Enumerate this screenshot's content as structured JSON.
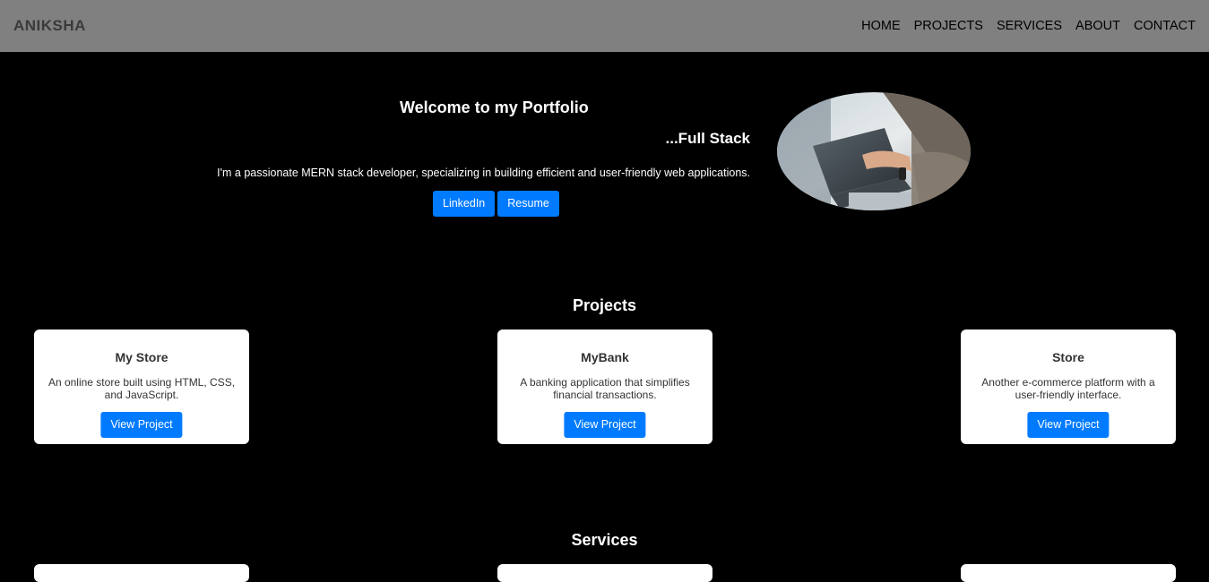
{
  "navbar": {
    "brand": "ANIKSHA",
    "links": [
      "HOME",
      "PROJECTS",
      "SERVICES",
      "ABOUT",
      "CONTACT"
    ]
  },
  "hero": {
    "title": "Welcome to my Portfolio",
    "role": "...Full Stack",
    "description": "I'm a passionate MERN stack developer, specializing in building efficient and user-friendly web applications.",
    "linkedin_label": "LinkedIn",
    "resume_label": "Resume"
  },
  "projects": {
    "heading": "Projects",
    "cards": [
      {
        "title": "My Store",
        "description": "An online store built using HTML, CSS, and JavaScript.",
        "button": "View Project"
      },
      {
        "title": "MyBank",
        "description": "A banking application that simplifies financial transactions.",
        "button": "View Project"
      },
      {
        "title": "Store",
        "description": "Another e-commerce platform with a user-friendly interface.",
        "button": "View Project"
      }
    ]
  },
  "services": {
    "heading": "Services"
  }
}
